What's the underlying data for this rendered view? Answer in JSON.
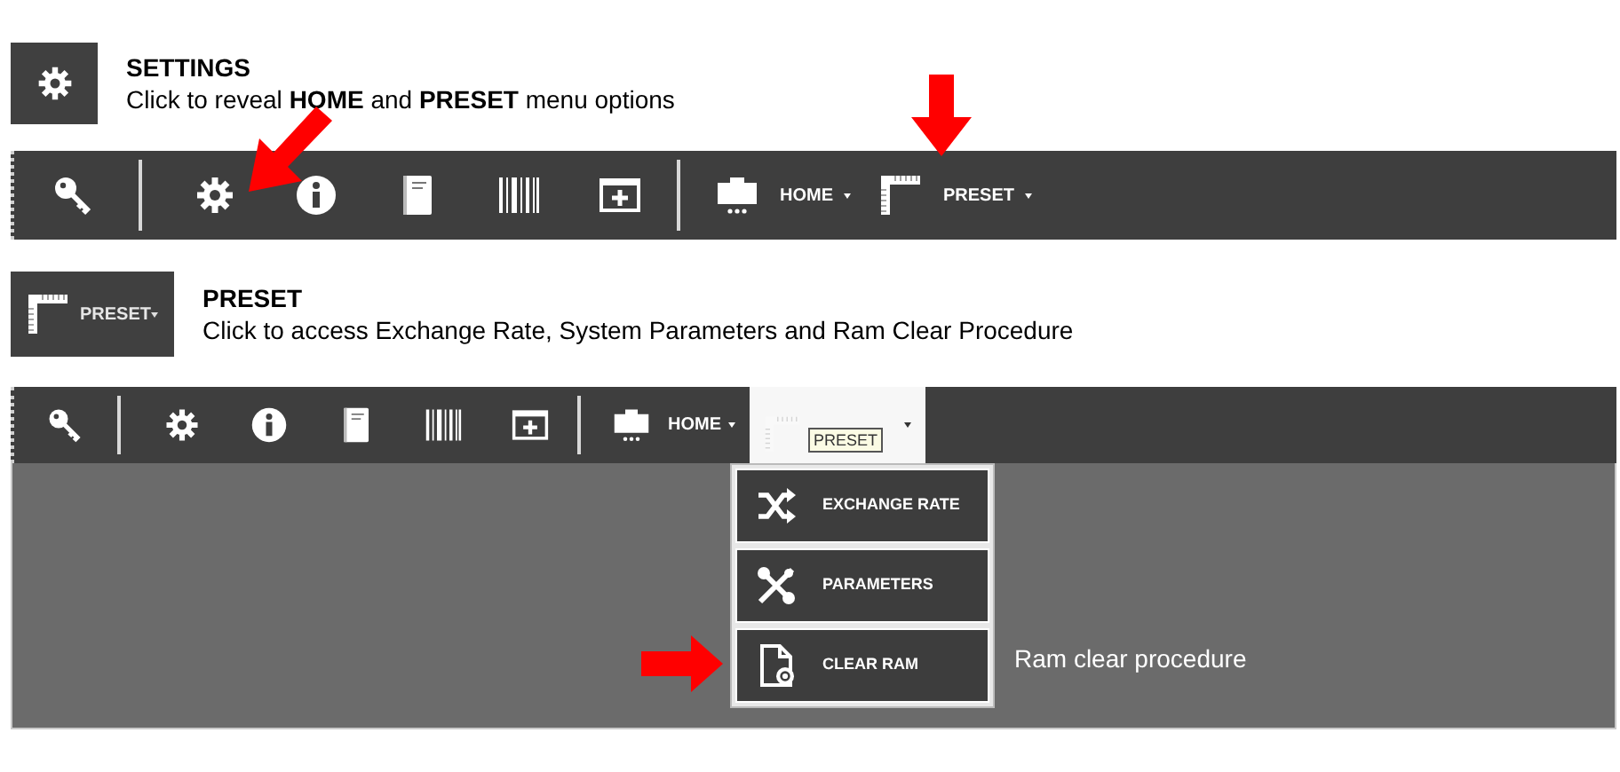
{
  "sections": [
    {
      "preview": {
        "kind": "gear"
      },
      "title": "SETTINGS",
      "description": "Click to reveal **HOME** and **PRESET** menu options",
      "toolbar": [
        {
          "kind": "key"
        },
        {
          "kind": "separator"
        },
        {
          "kind": "gear",
          "pointer": {
            "kind": "down-left"
          }
        },
        {
          "kind": "info"
        },
        {
          "kind": "book"
        },
        {
          "kind": "barcode"
        },
        {
          "kind": "window-plus"
        },
        {
          "kind": "separator"
        },
        {
          "kind": "briefcase",
          "label": "HOME",
          "expanded": false
        },
        {
          "kind": "ruler",
          "label": "PRESET",
          "expanded": false,
          "pointer": {
            "kind": "down"
          }
        }
      ]
    },
    {
      "preview": {
        "kind": "ruler",
        "label": "PRESET"
      },
      "title": "PRESET",
      "description": "Click to access Exchange Rate, System Parameters and Ram Clear Procedure",
      "toolbar": [
        {
          "kind": "key"
        },
        {
          "kind": "separator"
        },
        {
          "kind": "gear"
        },
        {
          "kind": "info"
        },
        {
          "kind": "book"
        },
        {
          "kind": "barcode"
        },
        {
          "kind": "window-plus"
        },
        {
          "kind": "separator"
        },
        {
          "kind": "briefcase",
          "label": "HOME",
          "expanded": false
        },
        {
          "kind": "ruler",
          "label": "PRESET",
          "expanded": true
        }
      ],
      "dropdown": [
        {
          "kind": "shuffle",
          "label": "EXCHANGE RATE"
        },
        {
          "kind": "tools",
          "label": "PARAMETERS"
        },
        {
          "kind": "file",
          "label": "CLEAR RAM",
          "pointer": {
            "kind": "right"
          }
        }
      ],
      "callout": "Ram clear procedure"
    }
  ]
}
